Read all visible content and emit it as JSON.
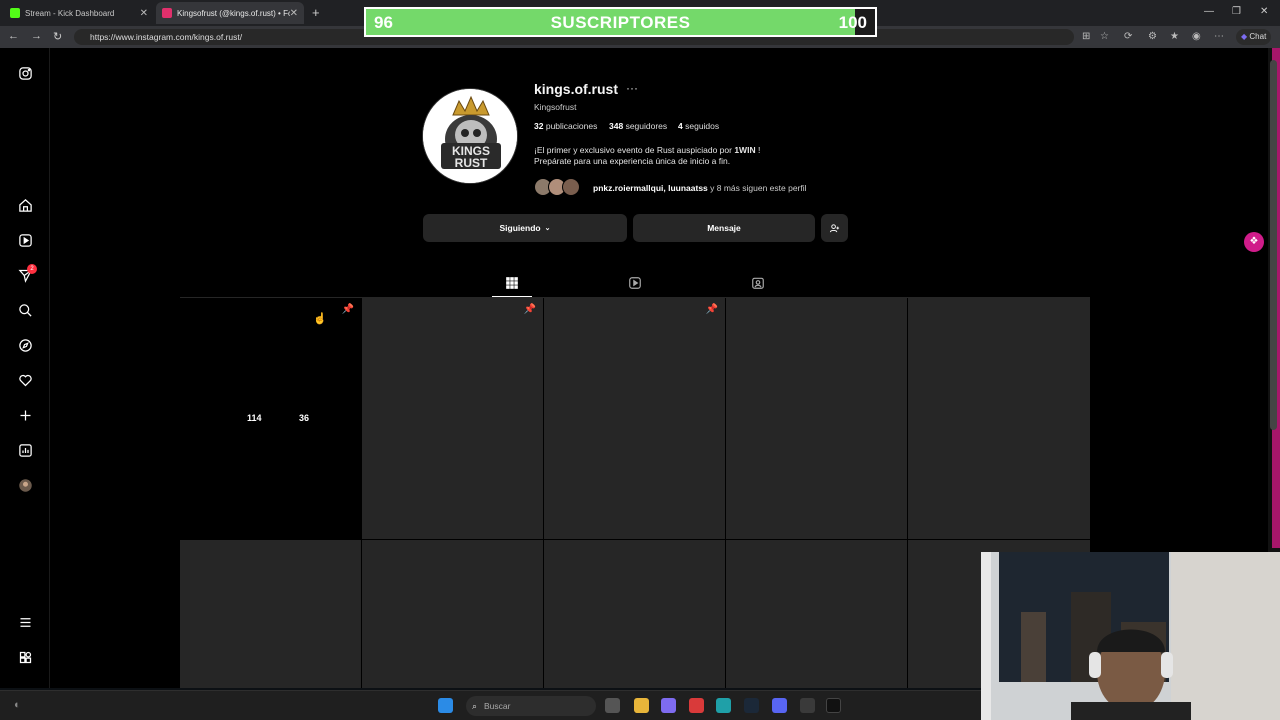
{
  "browser": {
    "tabs": [
      {
        "title": "Stream - Kick Dashboard",
        "favicon_color": "#53fc18"
      },
      {
        "title": "Kingsofrust (@kings.of.rust) • Foto",
        "favicon_color": "#e1306c"
      }
    ],
    "url": "https://www.instagram.com/kings.of.rust/",
    "chat_label": "Chat"
  },
  "overlay": {
    "current": "96",
    "label": "SUSCRIPTORES",
    "goal": "100",
    "progress_fraction": 0.96,
    "fill_color": "#74d96a"
  },
  "profile": {
    "username": "kings.of.rust",
    "more": "···",
    "full_name": "Kingsofrust",
    "avatar_text": "KINGS RUST",
    "stats": [
      {
        "value": "32",
        "label": "publicaciones"
      },
      {
        "value": "348",
        "label": "seguidores"
      },
      {
        "value": "4",
        "label": "seguidos"
      }
    ],
    "bio_line1_prefix": "¡El primer y exclusivo evento de Rust auspiciado por ",
    "bio_line1_bold": "1WIN",
    "bio_line1_suffix": " !",
    "bio_line2": "Prepárate para una experiencia única de inicio a fin.",
    "followed_by_names": "pnkz.roiermallqui, luunaatss",
    "followed_by_rest": " y 8 más siguen este perfil",
    "buttons": {
      "following": "Siguiendo",
      "message": "Mensaje"
    }
  },
  "grid": {
    "first_post_likes": "114",
    "first_post_comments": "36",
    "pinned_icon": "pin-icon"
  },
  "taskbar": {
    "search_placeholder": "Buscar"
  },
  "sidebar": {
    "notification_count": "2",
    "icons": [
      "instagram-icon",
      "home-icon",
      "reels-icon",
      "messages-icon",
      "search-icon",
      "explore-icon",
      "heart-icon",
      "create-icon",
      "dashboard-icon",
      "profile-avatar",
      "menu-icon",
      "more-apps-icon"
    ]
  }
}
